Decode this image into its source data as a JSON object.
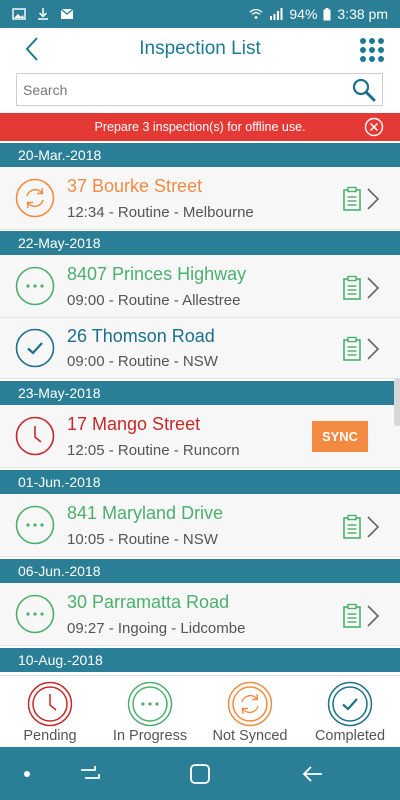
{
  "status_bar": {
    "battery": "94%",
    "time": "3:38 pm"
  },
  "header": {
    "title": "Inspection List"
  },
  "search": {
    "placeholder": "Search",
    "value": ""
  },
  "banner": {
    "text": "Prepare 3 inspection(s) for offline use."
  },
  "colors": {
    "teal": "#2a7f96",
    "orange": "#f38a42",
    "green": "#4caf6d",
    "blue": "#1b6f8a",
    "red": "#c62828"
  },
  "groups": [
    {
      "date": "20-Mar.-2018",
      "items": [
        {
          "title": "37 Bourke Street",
          "subtitle": "12:34 - Routine - Melbourne",
          "status": "not-synced"
        }
      ]
    },
    {
      "date": "22-May-2018",
      "items": [
        {
          "title": "8407 Princes Highway",
          "subtitle": "09:00 - Routine - Allestree",
          "status": "in-progress"
        },
        {
          "title": "26 Thomson Road",
          "subtitle": "09:00 - Routine - NSW",
          "status": "completed"
        }
      ]
    },
    {
      "date": "23-May-2018",
      "items": [
        {
          "title": "17 Mango Street",
          "subtitle": "12:05 - Routine - Runcorn",
          "status": "pending",
          "action": "SYNC"
        }
      ]
    },
    {
      "date": "01-Jun.-2018",
      "items": [
        {
          "title": "841 Maryland Drive",
          "subtitle": "10:05 - Routine - NSW",
          "status": "in-progress"
        }
      ]
    },
    {
      "date": "06-Jun.-2018",
      "items": [
        {
          "title": "30 Parramatta Road",
          "subtitle": "09:27 - Ingoing - Lidcombe",
          "status": "in-progress"
        }
      ]
    },
    {
      "date": "10-Aug.-2018",
      "items": []
    }
  ],
  "tabs": [
    {
      "label": "Pending",
      "icon": "clock-icon"
    },
    {
      "label": "In Progress",
      "icon": "dots-icon"
    },
    {
      "label": "Not Synced",
      "icon": "sync-icon"
    },
    {
      "label": "Completed",
      "icon": "check-icon"
    }
  ]
}
